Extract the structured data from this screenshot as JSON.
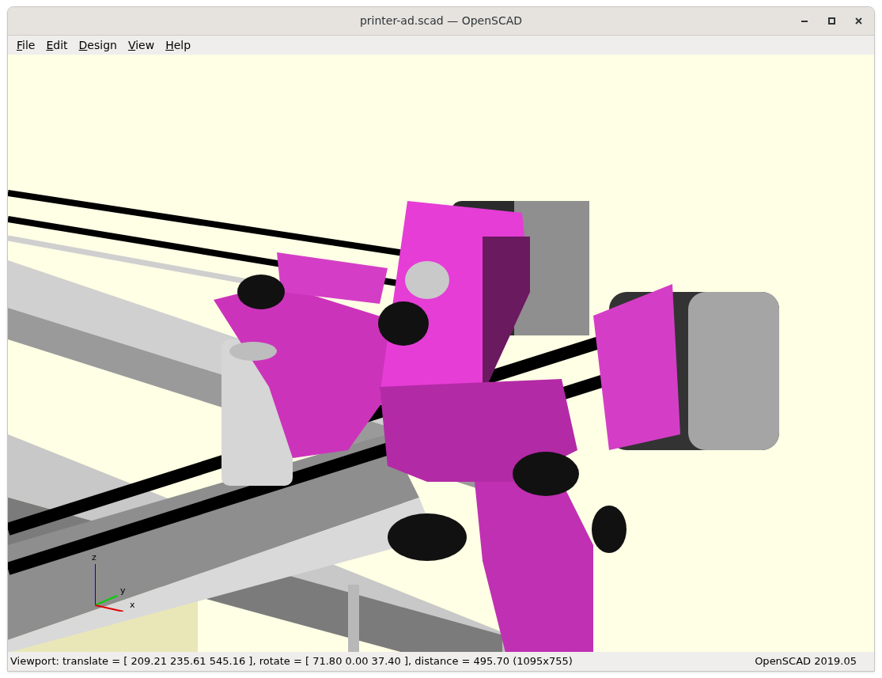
{
  "window": {
    "title": "printer-ad.scad — OpenSCAD"
  },
  "menu": [
    {
      "label": "File"
    },
    {
      "label": "Edit"
    },
    {
      "label": "Design"
    },
    {
      "label": "View"
    },
    {
      "label": "Help"
    }
  ],
  "viewport": {
    "axes": [
      "x",
      "y",
      "z"
    ]
  },
  "status_bar": {
    "viewport_info": "Viewport: translate = [ 209.21 235.61 545.16 ], rotate = [ 71.80 0.00 37.40 ], distance = 495.70 (1095x755)",
    "version": "OpenSCAD 2019.05"
  }
}
